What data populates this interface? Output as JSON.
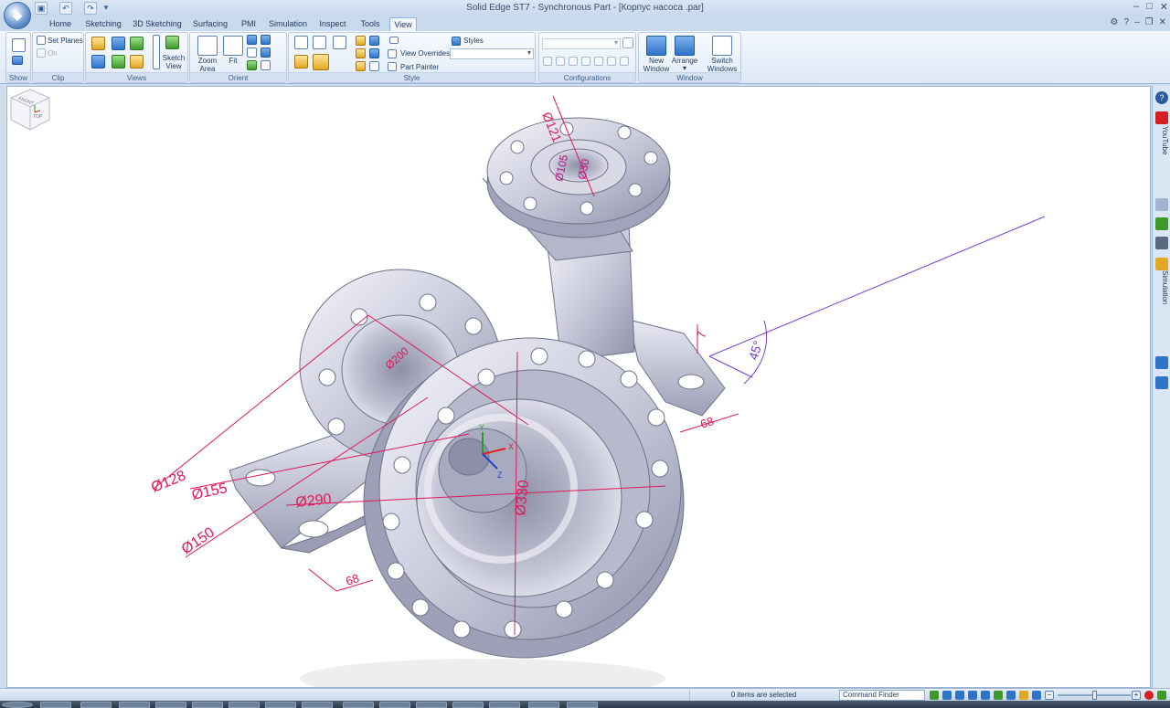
{
  "window": {
    "title": "Solid Edge ST7 - Synchronous Part - [Корпус насоса .par]",
    "controls": [
      "–",
      "□",
      "✕"
    ]
  },
  "quick_access": {
    "icons": [
      "save-icon",
      "undo-icon",
      "redo-icon",
      "customize-icon"
    ]
  },
  "tabs": [
    {
      "label": "Home"
    },
    {
      "label": "Sketching"
    },
    {
      "label": "3D Sketching"
    },
    {
      "label": "Surfacing"
    },
    {
      "label": "PMI"
    },
    {
      "label": "Simulation"
    },
    {
      "label": "Inspect"
    },
    {
      "label": "Tools"
    },
    {
      "label": "View",
      "active": true
    }
  ],
  "ribbon": {
    "groups": {
      "show": "Show",
      "clip": "Clip",
      "views": "Views",
      "orient": "Orient",
      "style": "Style",
      "configurations": "Configurations",
      "window": "Window"
    },
    "clip": {
      "set_planes": "Set Planes",
      "on": "On"
    },
    "views": {
      "sketch_view": "Sketch\nView"
    },
    "orient": {
      "zoom_area": "Zoom\nArea",
      "fit": "Fit"
    },
    "style": {
      "styles": "Styles",
      "view_overrides": "View Overrides",
      "part_painter": "Part Painter"
    },
    "window": {
      "new_window": "New\nWindow",
      "arrange": "Arrange",
      "switch_windows": "Switch\nWindows"
    }
  },
  "dimensions": {
    "d121": "Ø121",
    "d105": "Ø105",
    "d30": "Ø30",
    "d128": "Ø128",
    "d155": "Ø155",
    "d150": "Ø150",
    "d290": "Ø290",
    "d330": "Ø330",
    "d200": "Ø200",
    "len68_a": "68",
    "len68_b": "68",
    "len7": "7",
    "angle45": "45°"
  },
  "view_cube": {
    "front": "FRONT",
    "top": "TOP"
  },
  "dock": {
    "youtube": "YouTube",
    "simulation": "Simulation"
  },
  "status": {
    "message": "0 items are selected",
    "command_finder": "Command Finder"
  },
  "colors": {
    "dimension": "#e0185a",
    "angle": "#7a3fc8",
    "accent": "#2b5d9c"
  }
}
